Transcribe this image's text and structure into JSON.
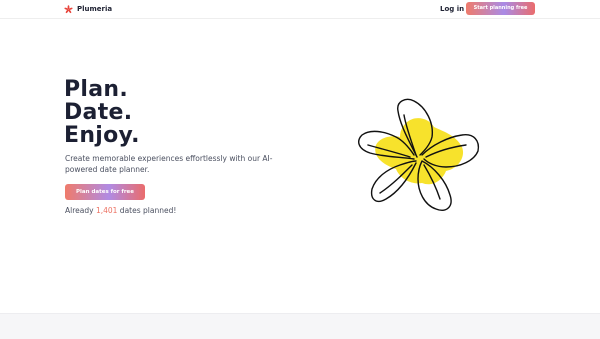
{
  "nav": {
    "brand_name": "Plumeria",
    "brand_icon": "plumeria-star-icon",
    "login_label": "Log in",
    "cta_label": "Start planning free"
  },
  "hero": {
    "title_lines": [
      "Plan.",
      "Date.",
      "Enjoy."
    ],
    "subtitle": "Create memorable experiences effortlessly with our AI-powered date planner.",
    "cta_label": "Plan dates for free",
    "count_prefix": "Already ",
    "count_value": "1,401",
    "count_suffix": " dates planned!"
  },
  "illustration": {
    "icon": "plumeria-flower-illustration",
    "fill_color": "#f7e22c",
    "stroke_color": "#111111"
  },
  "colors": {
    "accent_start": "#ef7b6b",
    "accent_mid": "#a98be6",
    "accent_end": "#ea6c6c",
    "count_highlight": "#ec7263",
    "text_dark": "#1c2033"
  }
}
